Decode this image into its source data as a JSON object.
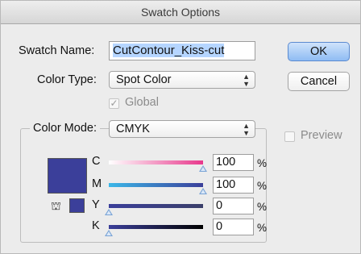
{
  "window": {
    "title": "Swatch Options"
  },
  "swatch_name": {
    "label": "Swatch Name:",
    "value": "CutContour_Kiss-cut"
  },
  "color_type": {
    "label": "Color Type:",
    "value": "Spot Color"
  },
  "global": {
    "label": "Global",
    "checked": true
  },
  "color_mode": {
    "label": "Color Mode:",
    "value": "CMYK"
  },
  "preview": {
    "label": "Preview",
    "checked": false
  },
  "buttons": {
    "ok": "OK",
    "cancel": "Cancel"
  },
  "swatch_color": "#3b3f9a",
  "channels": [
    {
      "label": "C",
      "value": "100",
      "unit": "%",
      "level": 1.0,
      "gradient": "linear-gradient(90deg,#ffffff,#e8388c)"
    },
    {
      "label": "M",
      "value": "100",
      "unit": "%",
      "level": 1.0,
      "gradient": "linear-gradient(90deg,#3bb7e8,#3b3f9a)"
    },
    {
      "label": "Y",
      "value": "0",
      "unit": "%",
      "level": 0.0,
      "gradient": "linear-gradient(90deg,#3b3f9a,#3b3f6a)"
    },
    {
      "label": "K",
      "value": "0",
      "unit": "%",
      "level": 0.0,
      "gradient": "linear-gradient(90deg,#3b3f9a,#000000)"
    }
  ]
}
